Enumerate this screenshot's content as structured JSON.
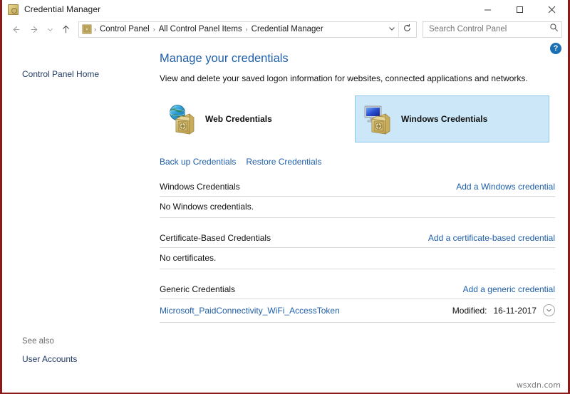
{
  "window": {
    "title": "Credential Manager",
    "icon": "vault-icon",
    "controls": {
      "minimize": "minimize-button",
      "maximize": "maximize-button",
      "close": "close-button"
    }
  },
  "nav": {
    "back": "back-button",
    "forward": "forward-button",
    "recent": "recent-locations-button",
    "up": "up-button",
    "breadcrumbs": [
      "Control Panel",
      "All Control Panel Items",
      "Credential Manager"
    ],
    "separator": "›",
    "dropdown": "⌄",
    "refresh": "↻"
  },
  "search": {
    "placeholder": "Search Control Panel",
    "value": "",
    "icon": "search-icon"
  },
  "sidebar": {
    "home_link": "Control Panel Home",
    "see_also_title": "See also",
    "see_also_link": "User Accounts"
  },
  "main": {
    "help": "?",
    "title": "Manage your credentials",
    "subtitle": "View and delete your saved logon information for websites, connected applications and networks.",
    "tiles": [
      {
        "label": "Web Credentials",
        "selected": false,
        "icon": "globe-vault-icon"
      },
      {
        "label": "Windows Credentials",
        "selected": true,
        "icon": "monitor-vault-icon"
      }
    ],
    "actions": [
      "Back up Credentials",
      "Restore Credentials"
    ],
    "sections": [
      {
        "title": "Windows Credentials",
        "action": "Add a Windows credential",
        "empty_text": "No Windows credentials.",
        "entries": []
      },
      {
        "title": "Certificate-Based Credentials",
        "action": "Add a certificate-based credential",
        "empty_text": "No certificates.",
        "entries": []
      },
      {
        "title": "Generic Credentials",
        "action": "Add a generic credential",
        "empty_text": "",
        "entries": [
          {
            "name": "Microsoft_PaidConnectivity_WiFi_AccessToken",
            "modified_label": "Modified:",
            "modified_date": "16-11-2017",
            "expander": "chevron-down-icon"
          }
        ]
      }
    ]
  },
  "watermark": "wsxdn.com",
  "colors": {
    "link": "#1f5fa9",
    "title": "#1f5fa9",
    "tile_selected_bg": "#cce8f8",
    "tile_selected_border": "#8fc7e8",
    "help_blue": "#1a6fb5",
    "window_border": "#8b1a1a",
    "divider": "#d9d9d9"
  }
}
